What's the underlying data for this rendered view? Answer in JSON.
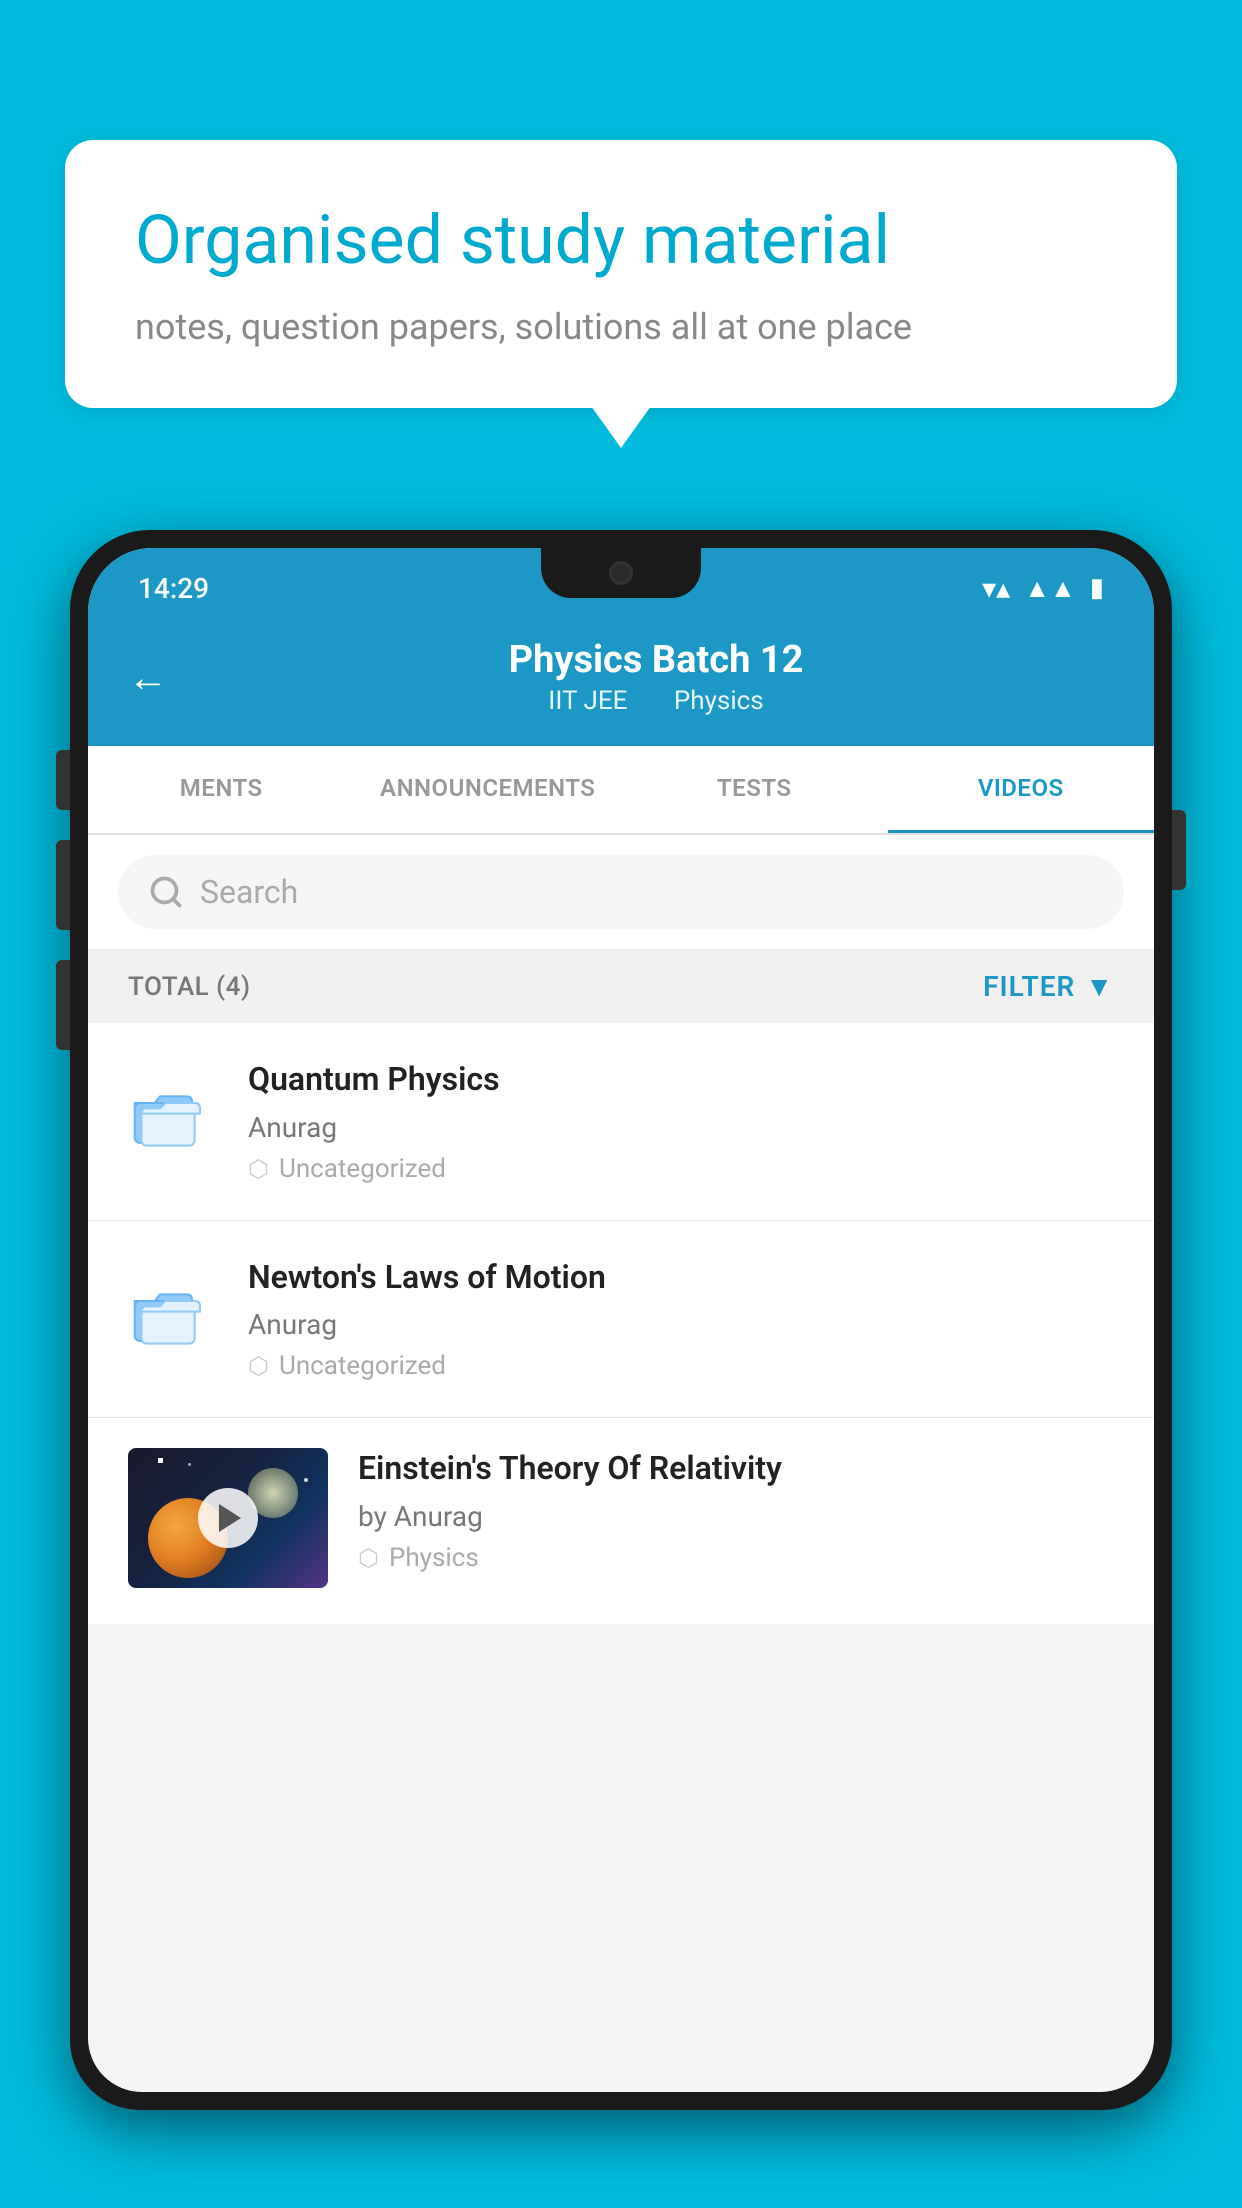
{
  "background_color": "#00BBDD",
  "speech_bubble": {
    "title": "Organised study material",
    "subtitle": "notes, question papers, solutions all at one place"
  },
  "status_bar": {
    "time": "14:29",
    "wifi": "▼▲",
    "battery": "▮"
  },
  "header": {
    "back_label": "←",
    "title": "Physics Batch 12",
    "tag1": "IIT JEE",
    "tag2": "Physics"
  },
  "tabs": [
    {
      "label": "MENTS",
      "active": false
    },
    {
      "label": "ANNOUNCEMENTS",
      "active": false
    },
    {
      "label": "TESTS",
      "active": false
    },
    {
      "label": "VIDEOS",
      "active": true
    }
  ],
  "search": {
    "placeholder": "Search"
  },
  "filter_bar": {
    "total_label": "TOTAL (4)",
    "filter_label": "FILTER"
  },
  "videos": [
    {
      "id": 1,
      "title": "Quantum Physics",
      "author": "Anurag",
      "tag": "Uncategorized",
      "type": "folder"
    },
    {
      "id": 2,
      "title": "Newton's Laws of Motion",
      "author": "Anurag",
      "tag": "Uncategorized",
      "type": "folder"
    },
    {
      "id": 3,
      "title": "Einstein's Theory Of Relativity",
      "author": "by Anurag",
      "tag": "Physics",
      "type": "video"
    }
  ]
}
